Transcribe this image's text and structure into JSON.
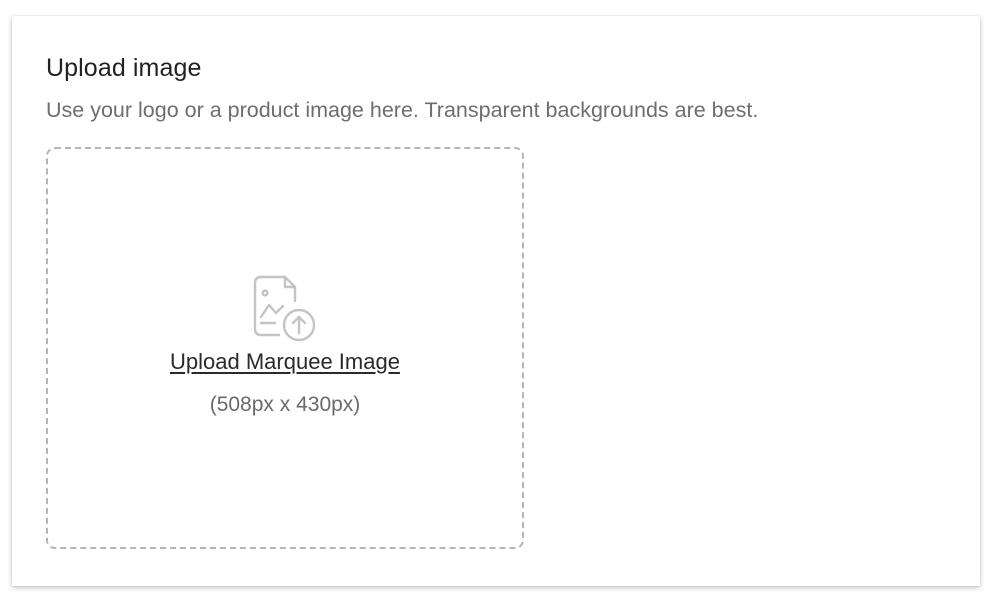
{
  "upload_section": {
    "title": "Upload image",
    "description": "Use your logo or a product image here. Transparent backgrounds are best.",
    "dropzone": {
      "icon": "image-upload-icon",
      "link_label": "Upload Marquee Image",
      "dimensions_hint": "(508px x 430px)"
    }
  },
  "colors": {
    "title": "#222222",
    "description": "#6e6e6e",
    "dropzone_border": "#b5b5b5",
    "icon": "#c4c4c4"
  }
}
